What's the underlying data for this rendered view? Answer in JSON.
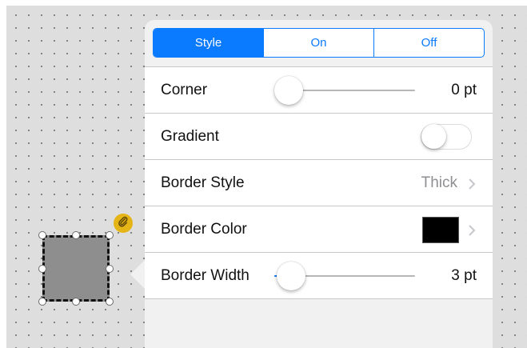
{
  "segmented_control": {
    "segments": [
      "Style",
      "On",
      "Off"
    ],
    "selected": "Style"
  },
  "rows": {
    "corner": {
      "label": "Corner",
      "value": "0 pt",
      "slider_fraction": 0.0
    },
    "gradient": {
      "label": "Gradient",
      "enabled": false
    },
    "border_style": {
      "label": "Border Style",
      "value": "Thick"
    },
    "border_color": {
      "label": "Border Color",
      "swatch_color": "#000000"
    },
    "border_width": {
      "label": "Border Width",
      "value": "3 pt",
      "slider_fraction": 0.12
    }
  },
  "icons": {
    "chevron": "chevron-right-icon",
    "link": "paperclip-icon"
  },
  "colors": {
    "accent": "#0a7aff",
    "shape_fill": "#8e8e8e",
    "badge": "#e5b416"
  }
}
